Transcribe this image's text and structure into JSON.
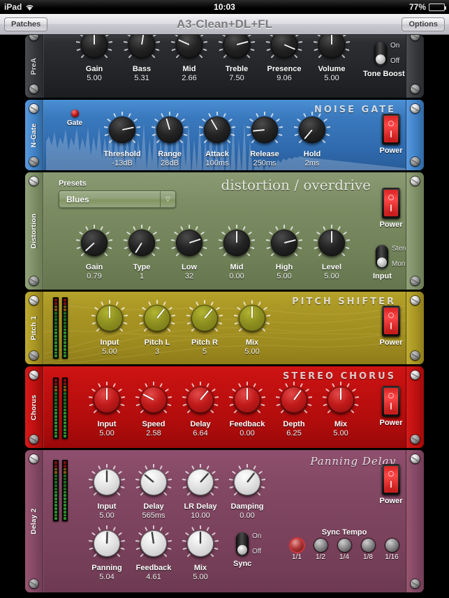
{
  "status_bar": {
    "carrier": "iPad",
    "wifi_icon": "wifi-icon",
    "time": "10:03",
    "battery_percent": "77%",
    "battery_icon": "battery-icon",
    "battery_level": 77
  },
  "nav_bar": {
    "left_button": "Patches",
    "title": "A3-Clean+DL+FL",
    "right_button": "Options"
  },
  "panels": [
    {
      "id": "preamp",
      "rail_label": "PreA",
      "brand": "",
      "knobs": [
        {
          "name": "Gain",
          "value": "5.00",
          "angle": 0
        },
        {
          "name": "Bass",
          "value": "5.31",
          "angle": 9
        },
        {
          "name": "Mid",
          "value": "2.66",
          "angle": -66
        },
        {
          "name": "Treble",
          "value": "7.50",
          "angle": 75
        },
        {
          "name": "Presence",
          "value": "9.06",
          "angle": 113
        },
        {
          "name": "Volume",
          "value": "5.00",
          "angle": 0
        }
      ],
      "toggle": {
        "caption": "Tone Boost",
        "options": [
          "On",
          "Off"
        ],
        "selected": "Off"
      }
    },
    {
      "id": "noise-gate",
      "rail_label": "N-Gate",
      "brand": "NOISE GATE",
      "led": {
        "label": "Gate",
        "color": "#b01010"
      },
      "knobs": [
        {
          "name": "Threshold",
          "value": "-13dB",
          "angle": 78
        },
        {
          "name": "Range",
          "value": "28dB",
          "angle": -16
        },
        {
          "name": "Attack",
          "value": "100ms",
          "angle": -30
        },
        {
          "name": "Release",
          "value": "250ms",
          "angle": -96
        },
        {
          "name": "Hold",
          "value": "2ms",
          "angle": -140
        }
      ],
      "power": {
        "label": "Power",
        "state": "on"
      }
    },
    {
      "id": "distortion",
      "rail_label": "Distortion",
      "brand": "distortion / overdrive",
      "presets": {
        "label": "Presets",
        "value": "Blues"
      },
      "knobs": [
        {
          "name": "Gain",
          "value": "0.79",
          "angle": -133
        },
        {
          "name": "Type",
          "value": "1",
          "angle": -148
        },
        {
          "name": "Low",
          "value": "32",
          "angle": 72
        },
        {
          "name": "Mid",
          "value": "0.00",
          "angle": 0
        },
        {
          "name": "High",
          "value": "5.00",
          "angle": 76
        },
        {
          "name": "Level",
          "value": "5.00",
          "angle": 0
        }
      ],
      "power": {
        "label": "Power",
        "state": "on"
      },
      "toggle": {
        "caption": "Input",
        "options": [
          "Stereo",
          "Mono"
        ],
        "selected": "Mono"
      }
    },
    {
      "id": "pitch-shifter",
      "rail_label": "Pitch 1",
      "brand": "PITCH SHIFTER",
      "meters": 2,
      "knobs": [
        {
          "name": "Input",
          "value": "5.00",
          "angle": 0
        },
        {
          "name": "Pitch L",
          "value": "3",
          "angle": 38
        },
        {
          "name": "Pitch R",
          "value": "5",
          "angle": 40
        },
        {
          "name": "Mix",
          "value": "5.00",
          "angle": 0
        }
      ],
      "power": {
        "label": "Power",
        "state": "on"
      }
    },
    {
      "id": "stereo-chorus",
      "rail_label": "Chorus",
      "brand": "STEREO CHORUS",
      "meters": 2,
      "knobs": [
        {
          "name": "Input",
          "value": "5.00",
          "angle": 0
        },
        {
          "name": "Speed",
          "value": "2.58",
          "angle": -62
        },
        {
          "name": "Delay",
          "value": "6.64",
          "angle": 40
        },
        {
          "name": "Feedback",
          "value": "0.00",
          "angle": 0
        },
        {
          "name": "Depth",
          "value": "6.25",
          "angle": 36
        },
        {
          "name": "Mix",
          "value": "5.00",
          "angle": 0
        }
      ],
      "power": {
        "label": "Power",
        "state": "on"
      }
    },
    {
      "id": "panning-delay",
      "rail_label": "Delay 2",
      "brand": "Panning Delay",
      "meters": 2,
      "knobs": [
        {
          "name": "Input",
          "value": "5.00",
          "angle": 0
        },
        {
          "name": "Delay",
          "value": "565ms",
          "angle": -50
        },
        {
          "name": "LR Delay",
          "value": "10.00",
          "angle": 42
        },
        {
          "name": "Damping",
          "value": "0.00",
          "angle": 38
        },
        {
          "name": "Panning",
          "value": "5.04",
          "angle": 2
        },
        {
          "name": "Feedback",
          "value": "4.61",
          "angle": -8
        },
        {
          "name": "Mix",
          "value": "5.00",
          "angle": 0
        }
      ],
      "power": {
        "label": "Power",
        "state": "on"
      },
      "toggle": {
        "caption": "Sync",
        "options": [
          "On",
          "Off"
        ],
        "selected": "Off"
      },
      "sync_tempo": {
        "title": "Sync Tempo",
        "options": [
          "1/1",
          "1/2",
          "1/4",
          "1/8",
          "1/16"
        ],
        "selected": "1/1"
      }
    }
  ],
  "colors": {
    "preamp": "#2c2e32",
    "noise_gate": "#3a79bd",
    "distortion": "#7b8c63",
    "pitch_shifter": "#a89523",
    "stereo_chorus": "#c21010",
    "panning_delay": "#834864",
    "power_on": "#ff4a4a"
  }
}
